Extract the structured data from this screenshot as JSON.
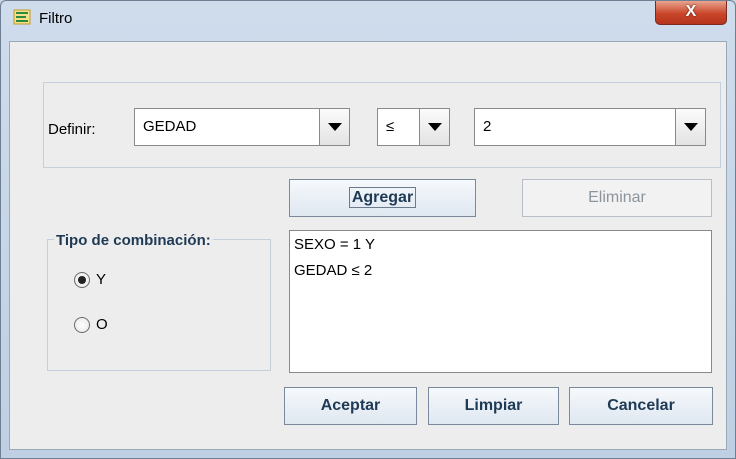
{
  "window": {
    "title": "Filtro",
    "close_label": "X"
  },
  "define": {
    "label": "Definir:",
    "variable": "GEDAD",
    "operator": "≤",
    "value": "2"
  },
  "buttons": {
    "add": "Agregar",
    "remove": "Eliminar",
    "accept": "Aceptar",
    "clear": "Limpiar",
    "cancel": "Cancelar"
  },
  "combination": {
    "legend": "Tipo de combinación:",
    "options": [
      {
        "label": "Y",
        "selected": true
      },
      {
        "label": "O",
        "selected": false
      }
    ]
  },
  "filters": [
    "SEXO = 1 Y",
    "GEDAD ≤ 2"
  ],
  "colors": {
    "title_accent": "#c9452a",
    "label_text": "#1f3a55"
  }
}
